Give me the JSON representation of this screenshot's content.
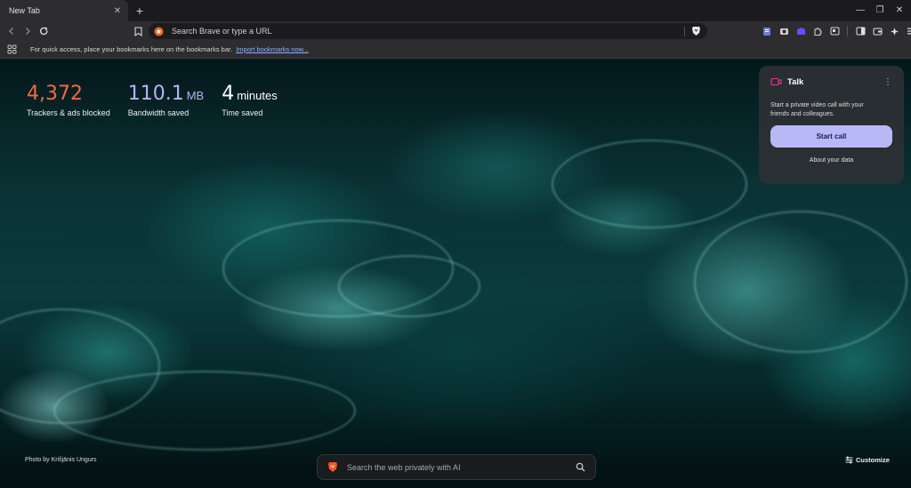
{
  "tab": {
    "title": "New Tab",
    "close_icon": "close-icon"
  },
  "toolbar": {
    "omnibox_text": "Search Brave or type a URL"
  },
  "bookmarks_bar": {
    "hint": "For quick access, place your bookmarks here on the bookmarks bar.",
    "import_link": "Import bookmarks now..."
  },
  "stats": [
    {
      "value": "4,372",
      "unit": "",
      "label": "Trackers & ads blocked",
      "color": "#f26b43"
    },
    {
      "value": "110.1",
      "unit": "MB",
      "label": "Bandwidth saved",
      "color": "#b7b2f5"
    },
    {
      "value": "4",
      "unit": "minutes",
      "label": "Time saved",
      "color": "#ffffff"
    }
  ],
  "talk_card": {
    "title": "Talk",
    "description": "Start a private video call with your friends and colleagues.",
    "start_button": "Start call",
    "about_link": "About your data",
    "accent": "#b9b8f7"
  },
  "photo_credit": "Photo by Krišjānis Ungurs",
  "search": {
    "placeholder": "Search the web privately with AI"
  },
  "customize_label": "Customize"
}
